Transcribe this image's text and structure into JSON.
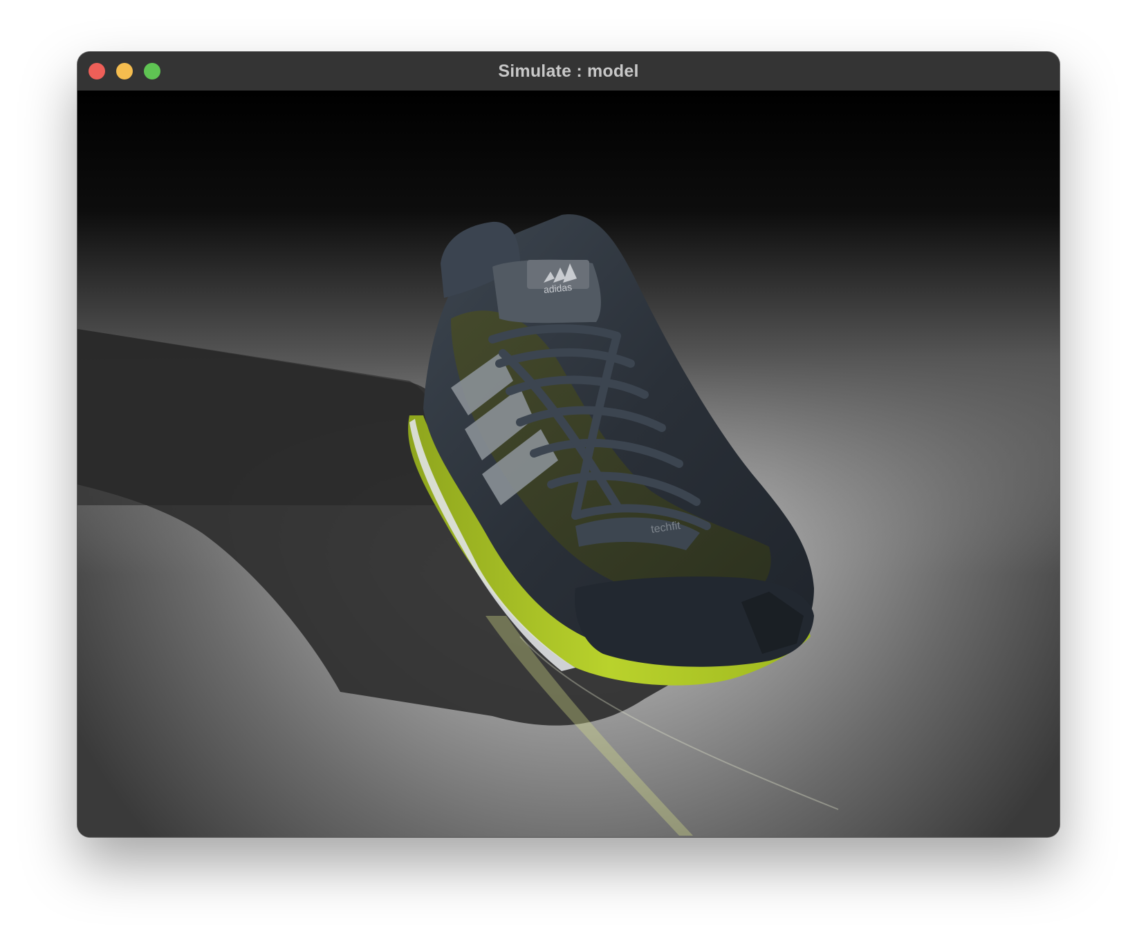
{
  "window": {
    "title": "Simulate : model",
    "controls": {
      "close_color": "#ee5f58",
      "minimize_color": "#f5bd4f",
      "maximize_color": "#5fc453"
    }
  },
  "viewport": {
    "scene": "textured 3D shoe model on a lit floor",
    "model": {
      "brand_text": "adidas",
      "tongue_text": "techfit"
    },
    "colors": {
      "background_top": "#050505",
      "floor_light": "#b4b4b4",
      "shadow": "#2e2e2e",
      "upper": "#2f3640",
      "accent": "#b5cf2a",
      "midsole": "#d8dadc"
    }
  }
}
